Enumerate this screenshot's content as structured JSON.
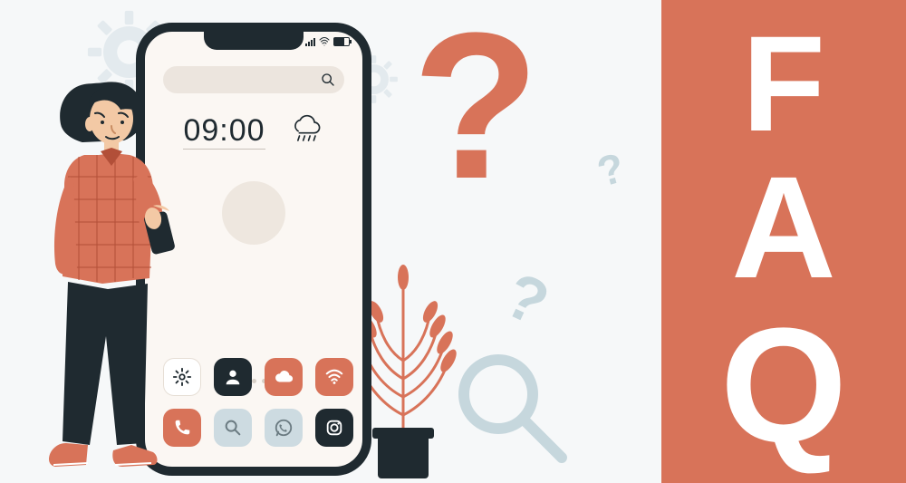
{
  "faq": {
    "f": "F",
    "a": "A",
    "q": "Q"
  },
  "big_question_mark": "?",
  "mini_question_1": "?",
  "mini_question_2": "?",
  "phone": {
    "clock": "09:00",
    "status": {
      "signal_bars": 4,
      "wifi": true,
      "battery_pct": 70
    },
    "search_placeholder": "",
    "pager_dots": 5,
    "pager_active": 0,
    "apps_row1": [
      {
        "name": "settings",
        "bg": "#ffffff",
        "fg": "#1f2a30"
      },
      {
        "name": "contacts",
        "bg": "#1f2a30",
        "fg": "#ffffff"
      },
      {
        "name": "cloud",
        "bg": "#d87359",
        "fg": "#ffffff"
      },
      {
        "name": "wifi",
        "bg": "#d87359",
        "fg": "#ffffff"
      }
    ],
    "apps_row2": [
      {
        "name": "phone",
        "bg": "#d87359",
        "fg": "#ffffff"
      },
      {
        "name": "search",
        "bg": "#cddbe1",
        "fg": "#6b7b82"
      },
      {
        "name": "whatsapp",
        "bg": "#cddbe1",
        "fg": "#6b7b82"
      },
      {
        "name": "instagram",
        "bg": "#1f2a30",
        "fg": "#ffffff"
      }
    ]
  },
  "colors": {
    "coral": "#d87359",
    "dark": "#1f2a30",
    "pale": "#cddbe1",
    "cream": "#fbf7f3"
  }
}
